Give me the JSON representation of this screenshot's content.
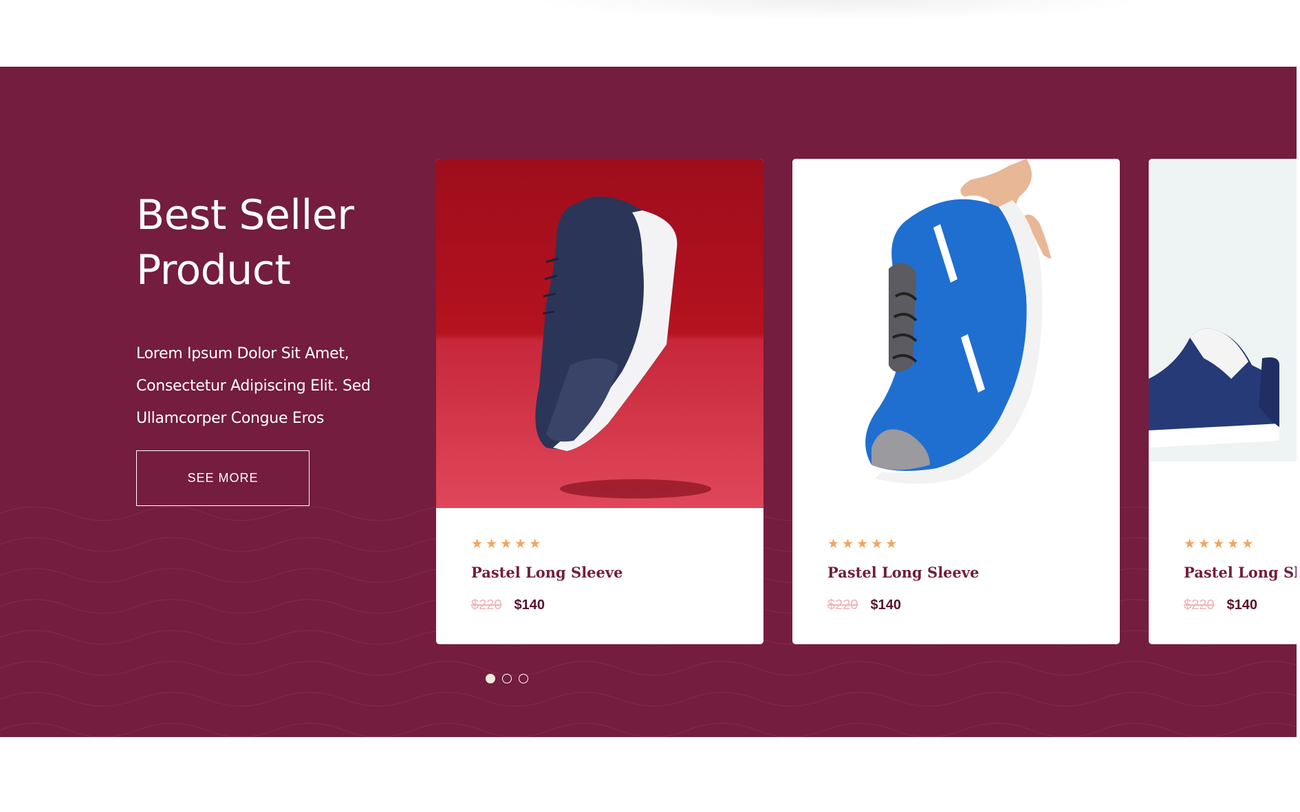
{
  "section": {
    "title_line1": "Best Seller",
    "title_line2": "Product",
    "description_line1": "Lorem Ipsum Dolor Sit Amet,",
    "description_line2": "Consectetur Adipiscing Elit. Sed",
    "description_line3": "Ullamcorper Congue Eros",
    "button_label": "SEE MORE",
    "background_color": "#741d3e"
  },
  "products": [
    {
      "title": "Pastel Long Sleeve",
      "old_price": "$220",
      "price": "$140",
      "rating": 5,
      "image": "navy-sneaker-on-red-backdrop"
    },
    {
      "title": "Pastel Long Sleeve",
      "old_price": "$220",
      "price": "$140",
      "rating": 5,
      "image": "blue-sneaker-held-by-hand"
    },
    {
      "title": "Pastel Long Sleeve",
      "old_price": "$220",
      "price": "$140",
      "rating": 5,
      "image": "navy-white-sneakers-pair"
    }
  ],
  "carousel": {
    "pages": 3,
    "active_page": 1
  },
  "colors": {
    "star": "#f5a35c",
    "old_price": "#f0b3b5",
    "title": "#741d3e"
  },
  "icons": {
    "star": "star-icon",
    "dot": "carousel-dot-icon"
  }
}
